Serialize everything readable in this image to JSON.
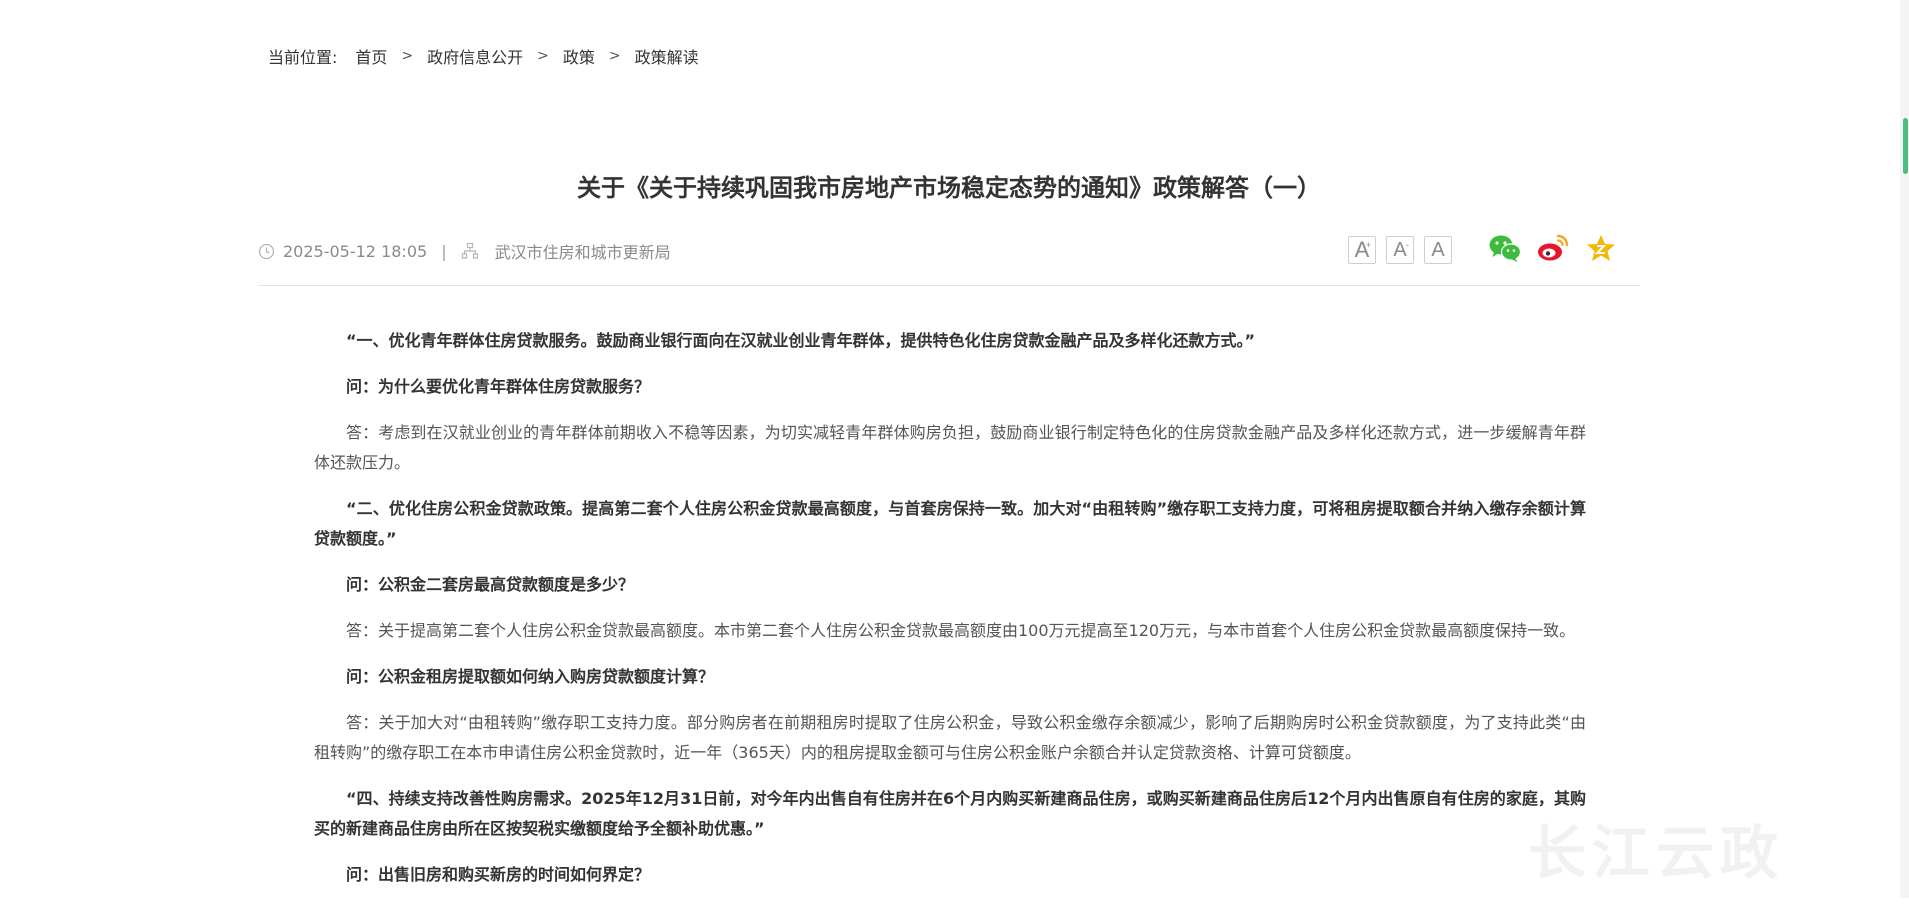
{
  "breadcrumb": {
    "prefix": "当前位置:",
    "items": [
      {
        "label": "首页"
      },
      {
        "label": "政府信息公开"
      },
      {
        "label": "政策"
      },
      {
        "label": "政策解读"
      }
    ],
    "separator": ">"
  },
  "article": {
    "title": "关于《关于持续巩固我市房地产市场稳定态势的通知》政策解答（一）",
    "date": "2025-05-12 18:05",
    "meta_separator": "|",
    "source": "武汉市住房和城市更新局",
    "font_controls": {
      "large": "A",
      "large_sup": "+",
      "medium": "A",
      "medium_sup": "-",
      "small": "A"
    },
    "share": [
      "wechat-icon",
      "weibo-icon",
      "favorite-star-icon"
    ],
    "paragraphs": [
      {
        "type": "q-bold",
        "text": "“一、优化青年群体住房贷款服务。鼓励商业银行面向在汉就业创业青年群体，提供特色化住房贷款金融产品及多样化还款方式。”"
      },
      {
        "type": "q-bold",
        "text": "问：为什么要优化青年群体住房贷款服务？"
      },
      {
        "type": "answer",
        "text": "答：考虑到在汉就业创业的青年群体前期收入不稳等因素，为切实减轻青年群体购房负担，鼓励商业银行制定特色化的住房贷款金融产品及多样化还款方式，进一步缓解青年群体还款压力。"
      },
      {
        "type": "q-bold",
        "text": "“二、优化住房公积金贷款政策。提高第二套个人住房公积金贷款最高额度，与首套房保持一致。加大对“由租转购”缴存职工支持力度，可将租房提取额合并纳入缴存余额计算贷款额度。”"
      },
      {
        "type": "q-bold",
        "text": "问：公积金二套房最高贷款额度是多少？"
      },
      {
        "type": "answer",
        "text": "答：关于提高第二套个人住房公积金贷款最高额度。本市第二套个人住房公积金贷款最高额度由100万元提高至120万元，与本市首套个人住房公积金贷款最高额度保持一致。"
      },
      {
        "type": "q-bold",
        "text": "问：公积金租房提取额如何纳入购房贷款额度计算？"
      },
      {
        "type": "answer",
        "text": "答：关于加大对“由租转购”缴存职工支持力度。部分购房者在前期租房时提取了住房公积金，导致公积金缴存余额减少，影响了后期购房时公积金贷款额度，为了支持此类“由租转购”的缴存职工在本市申请住房公积金贷款时，近一年（365天）内的租房提取金额可与住房公积金账户余额合并认定贷款资格、计算可贷额度。"
      },
      {
        "type": "q-bold",
        "text": "“四、持续支持改善性购房需求。2025年12月31日前，对今年内出售自有住房并在6个月内购买新建商品住房，或购买新建商品住房后12个月内出售原自有住房的家庭，其购买的新建商品住房由所在区按契税实缴额度给予全额补助优惠。”"
      },
      {
        "type": "q-bold",
        "text": "问：出售旧房和购买新房的时间如何界定？"
      }
    ]
  },
  "watermark": "长江云政",
  "colors": {
    "accent_green": "#4bbf7f",
    "wechat": "#3dbb3c",
    "weibo": "#e6162d",
    "star": "#f5b800"
  }
}
